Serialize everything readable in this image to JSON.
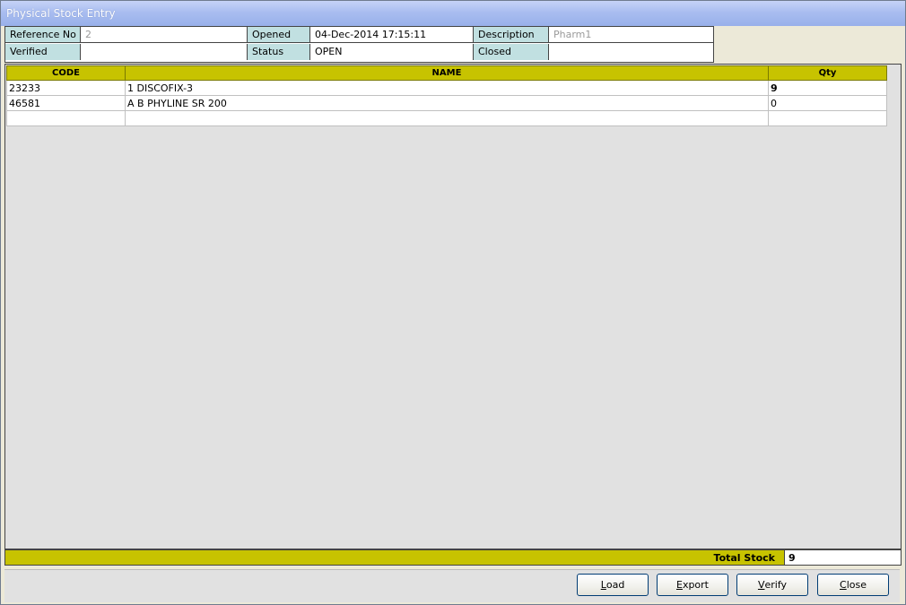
{
  "window": {
    "title": "Physical Stock Entry"
  },
  "info": {
    "reference_no_label": "Reference No",
    "reference_no_value": "2",
    "opened_label": "Opened",
    "opened_value": "04-Dec-2014 17:15:11",
    "description_label": "Description",
    "description_value": "Pharm1",
    "verified_label": "Verified",
    "verified_value": "",
    "status_label": "Status",
    "status_value": "OPEN",
    "closed_label": "Closed",
    "closed_value": ""
  },
  "grid": {
    "columns": [
      "CODE",
      "NAME",
      "Qty"
    ],
    "rows": [
      {
        "code": "23233",
        "name": "1 DISCOFIX-3",
        "qty": "9"
      },
      {
        "code": "46581",
        "name": "A B PHYLINE SR 200",
        "qty": "0"
      },
      {
        "code": "",
        "name": "",
        "qty": ""
      }
    ]
  },
  "totals": {
    "label": "Total Stock",
    "value": "9"
  },
  "buttons": {
    "load": {
      "first": "L",
      "rest": "oad"
    },
    "export": {
      "first": "E",
      "rest": "xport"
    },
    "verify": {
      "first": "V",
      "rest": "erify"
    },
    "close": {
      "first": "C",
      "rest": "lose"
    }
  },
  "colors": {
    "header_bg": "#c7c300",
    "label_bg": "#c1e0e1",
    "titlebar": "#a9bdf0"
  }
}
